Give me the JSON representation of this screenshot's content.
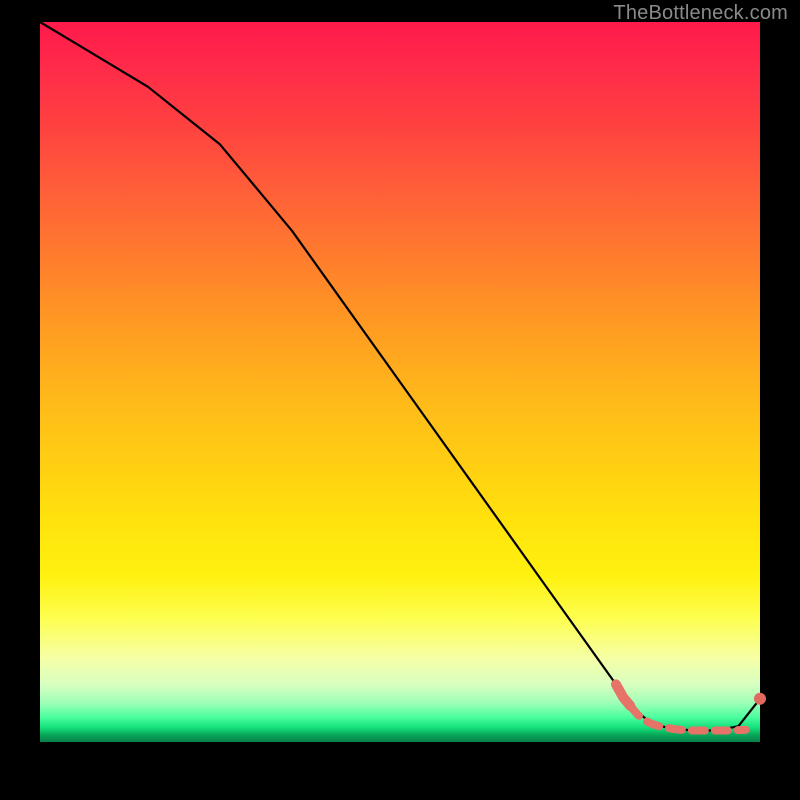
{
  "attribution": "TheBottleneck.com",
  "colors": {
    "black_line": "#000000",
    "dotted_line": "#e57368",
    "end_dot": "#e06a60"
  },
  "chart_data": {
    "type": "line",
    "title": "",
    "xlabel": "",
    "ylabel": "",
    "xlim": [
      0,
      100
    ],
    "ylim": [
      0,
      100
    ],
    "grid": false,
    "series": [
      {
        "name": "main-curve",
        "style": "solid-thin-black",
        "x": [
          0,
          5,
          10,
          15,
          20,
          25,
          30,
          35,
          40,
          45,
          50,
          55,
          60,
          65,
          70,
          75,
          80,
          82,
          85,
          88,
          91,
          94,
          97,
          100
        ],
        "y": [
          100,
          97,
          94,
          91,
          87,
          83,
          77,
          71,
          64,
          57,
          50,
          43,
          36,
          29,
          22,
          15,
          8,
          5,
          2.5,
          1.8,
          1.6,
          1.6,
          2.2,
          6
        ]
      },
      {
        "name": "recommendation-band",
        "style": "thick-dashed-salmon",
        "x": [
          80,
          81,
          82,
          83,
          84,
          85,
          86,
          88,
          90,
          92,
          94,
          96,
          98
        ],
        "y": [
          8,
          6.2,
          5,
          3.8,
          3,
          2.5,
          2.2,
          1.8,
          1.6,
          1.6,
          1.6,
          1.6,
          1.7
        ]
      },
      {
        "name": "end-dot",
        "style": "point-salmon",
        "x": [
          100
        ],
        "y": [
          6
        ]
      }
    ]
  }
}
